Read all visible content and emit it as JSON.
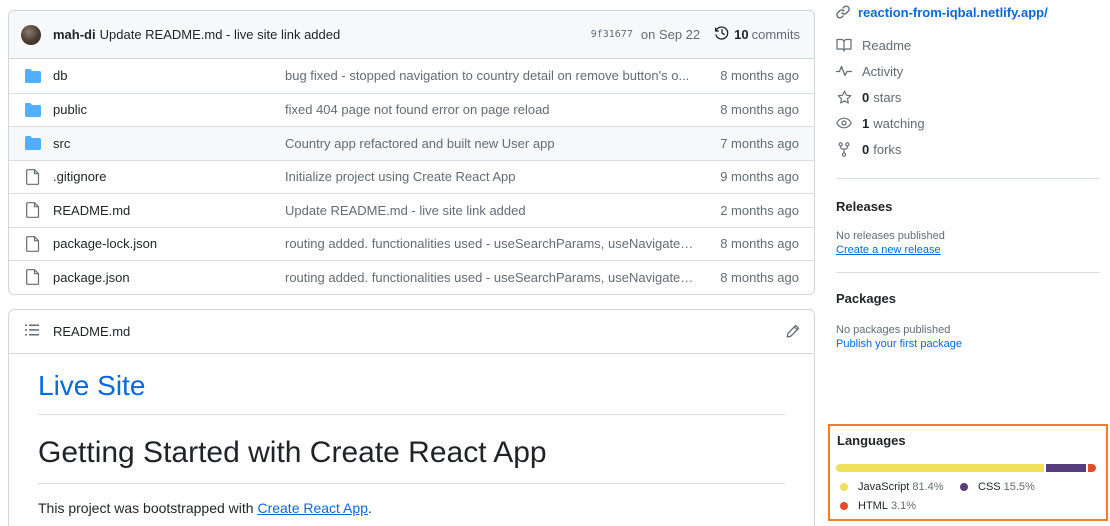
{
  "commit": {
    "author": "mah-di",
    "message": "Update README.md - live site link added",
    "sha": "9f31677",
    "date": "on Sep 22",
    "commits_count": "10",
    "commits_label": "commits"
  },
  "files": [
    {
      "name": "db",
      "type": "folder",
      "message": "bug fixed - stopped navigation to country detail on remove button's o...",
      "date": "8 months ago"
    },
    {
      "name": "public",
      "type": "folder",
      "message": "fixed 404 page not found error on page reload",
      "date": "8 months ago"
    },
    {
      "name": "src",
      "type": "folder",
      "message": "Country app refactored and built new User app",
      "date": "7 months ago"
    },
    {
      "name": ".gitignore",
      "type": "file",
      "message": "Initialize project using Create React App",
      "date": "9 months ago"
    },
    {
      "name": "README.md",
      "type": "file",
      "message": "Update README.md - live site link added",
      "date": "2 months ago"
    },
    {
      "name": "package-lock.json",
      "type": "file",
      "message": "routing added. functionalities used - useSearchParams, useNavigate, u...",
      "date": "8 months ago"
    },
    {
      "name": "package.json",
      "type": "file",
      "message": "routing added. functionalities used - useSearchParams, useNavigate, u...",
      "date": "8 months ago"
    }
  ],
  "readme": {
    "filename": "README.md",
    "h1": "Live Site",
    "h2": "Getting Started with Create React App",
    "para_prefix": "This project was bootstrapped with ",
    "para_link": "Create React App",
    "para_suffix": "."
  },
  "about": {
    "website": "reaction-from-iqbal.netlify.app/",
    "readme_label": "Readme",
    "activity_label": "Activity",
    "stars_count": "0",
    "stars_label": "stars",
    "watching_count": "1",
    "watching_label": "watching",
    "forks_count": "0",
    "forks_label": "forks"
  },
  "releases": {
    "title": "Releases",
    "empty": "No releases published",
    "link": "Create a new release"
  },
  "packages": {
    "title": "Packages",
    "empty": "No packages published",
    "link": "Publish your first package"
  },
  "languages": {
    "title": "Languages",
    "items": [
      {
        "name": "JavaScript",
        "percent": "81.4%",
        "value": 81.4,
        "color": "#f1e05a"
      },
      {
        "name": "CSS",
        "percent": "15.5%",
        "value": 15.5,
        "color": "#563d7c"
      },
      {
        "name": "HTML",
        "percent": "3.1%",
        "value": 3.1,
        "color": "#e34c26"
      }
    ]
  },
  "colors": {
    "link": "#0969da",
    "highlight_border": "#ef7f28",
    "folder": "#54aeff"
  }
}
